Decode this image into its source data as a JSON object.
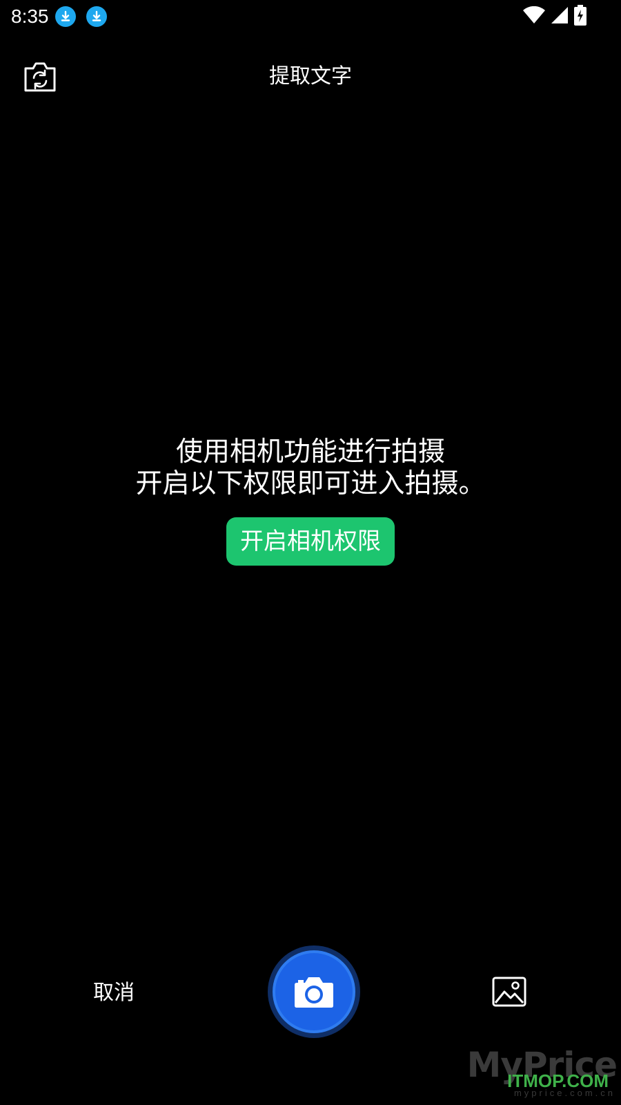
{
  "status_bar": {
    "time": "8:35",
    "notification_icons": [
      "download-icon",
      "download-icon"
    ],
    "system_icons": [
      "wifi-icon",
      "cellular-signal-icon",
      "battery-charging-icon"
    ],
    "badge_color": "#1ea8ef"
  },
  "app_bar": {
    "title": "提取文字",
    "left_icon": "flip-camera-icon"
  },
  "permission_prompt": {
    "line1": "使用相机功能进行拍摄",
    "line2": "开启以下权限即可进入拍摄。",
    "button_label": "开启相机权限",
    "button_color": "#1dc56f"
  },
  "bottom_bar": {
    "cancel_label": "取消",
    "shutter_icon": "camera-icon",
    "shutter_color": "#1c63e6",
    "gallery_icon": "gallery-icon"
  },
  "watermark": {
    "back_text": "MyPrice",
    "front_text": "ITMOP.COM",
    "sub_text": "myprice.com.cn"
  }
}
